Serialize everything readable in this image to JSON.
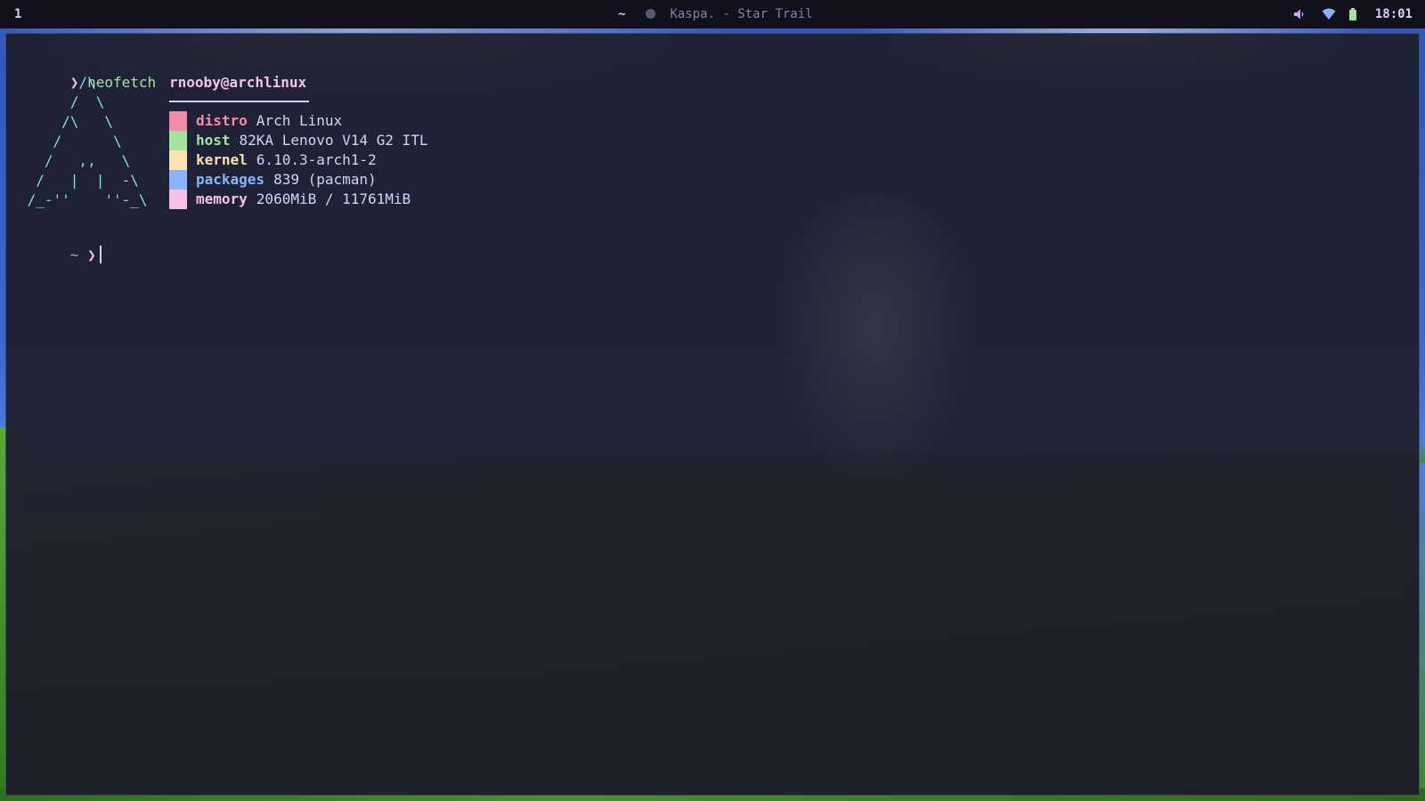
{
  "topbar": {
    "workspace": "1",
    "cwd": "~",
    "media_icon": "disc-icon",
    "media_title": "Kaspa. - Star Trail",
    "tray_icons": [
      "volume-icon",
      "wifi-icon",
      "battery-icon"
    ],
    "clock": "18:01"
  },
  "terminal": {
    "prompt_symbol": "❯",
    "command": "neofetch",
    "logo_lines": [
      "       /\\",
      "      /  \\",
      "     /\\   \\",
      "    /      \\",
      "   /   ,,   \\",
      "  /   |  |  -\\",
      " /_-''    ''-_\\"
    ],
    "userhost": "rnooby@archlinux",
    "info": [
      {
        "key": "distro",
        "value": "Arch Linux",
        "color": "#f38ba8"
      },
      {
        "key": "host",
        "value": "82KA Lenovo V14 G2 ITL",
        "color": "#a6e3a1"
      },
      {
        "key": "kernel",
        "value": "6.10.3-arch1-2",
        "color": "#f9e2af"
      },
      {
        "key": "packages",
        "value": "839 (pacman)",
        "color": "#89b4fa"
      },
      {
        "key": "memory",
        "value": "2060MiB / 11761MiB",
        "color": "#f5c2e7"
      }
    ],
    "prompt2_dir": "~",
    "prompt2_symbol": "❯"
  },
  "colors": {
    "bar_bg": "#11111b",
    "terminal_bg": "#1e1e2e",
    "accent_pink": "#f5c2e7",
    "accent_green": "#a6e3a1",
    "accent_cyan": "#89dceb"
  }
}
